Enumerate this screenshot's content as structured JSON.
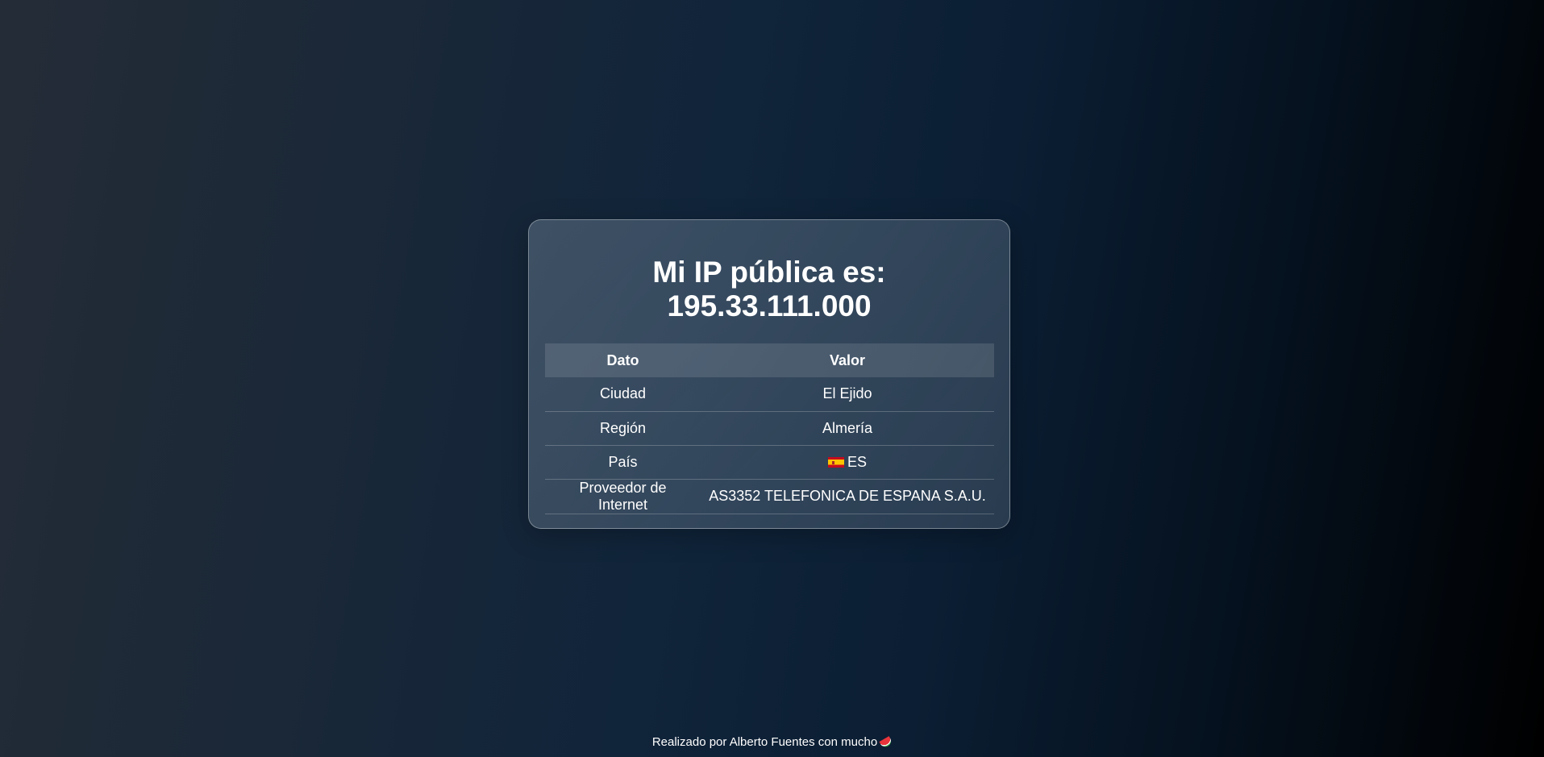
{
  "card": {
    "title_line1": "Mi IP pública es:",
    "title_line2": "195.33.111.000"
  },
  "table": {
    "headers": [
      "Dato",
      "Valor"
    ],
    "rows": [
      {
        "label": "Ciudad",
        "value": "El Ejido"
      },
      {
        "label": "Región",
        "value": "Almería"
      },
      {
        "label": "País",
        "value": "ES",
        "flag_icon": "spain-flag-icon"
      },
      {
        "label": "Proveedor de Internet",
        "value": "AS3352 TELEFONICA DE ESPANA S.A.U."
      }
    ]
  },
  "footer": {
    "text": "Realizado por Alberto Fuentes con mucho",
    "icon": "watermelon-icon"
  },
  "colors": {
    "background_start": "#242c37",
    "background_mid": "#10243a",
    "background_end": "#000000",
    "text": "#ffffff"
  }
}
